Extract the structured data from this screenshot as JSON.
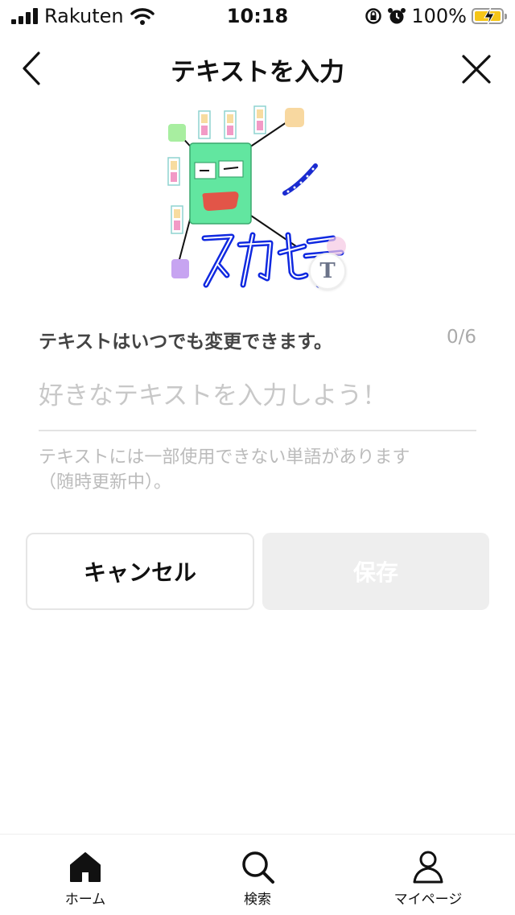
{
  "status_bar": {
    "carrier": "Rakuten",
    "time": "10:18",
    "battery_percent": "100%"
  },
  "header": {
    "title": "テキストを入力",
    "back_icon": "chevron-left-icon",
    "close_icon": "close-icon"
  },
  "sticker": {
    "text_badge": "T",
    "handwritten_text": "ネカセテ"
  },
  "text_editor": {
    "hint": "テキストはいつでも変更できます。",
    "counter": "0/6",
    "value": "",
    "placeholder": "好きなテキストを入力しよう！",
    "notice_line1": "テキストには一部使用できない単語があります",
    "notice_line2": "（随時更新中）。"
  },
  "actions": {
    "cancel_label": "キャンセル",
    "save_label": "保存",
    "save_enabled": false
  },
  "tab_bar": {
    "tabs": [
      {
        "label": "ホーム",
        "icon": "home-icon"
      },
      {
        "label": "検索",
        "icon": "search-icon"
      },
      {
        "label": "マイページ",
        "icon": "person-icon"
      }
    ]
  },
  "colors": {
    "sticker_body": "#62e6a0",
    "sticker_text": "#1029e0",
    "battery": "#f5c518",
    "save_disabled_bg": "#eeeeee"
  }
}
